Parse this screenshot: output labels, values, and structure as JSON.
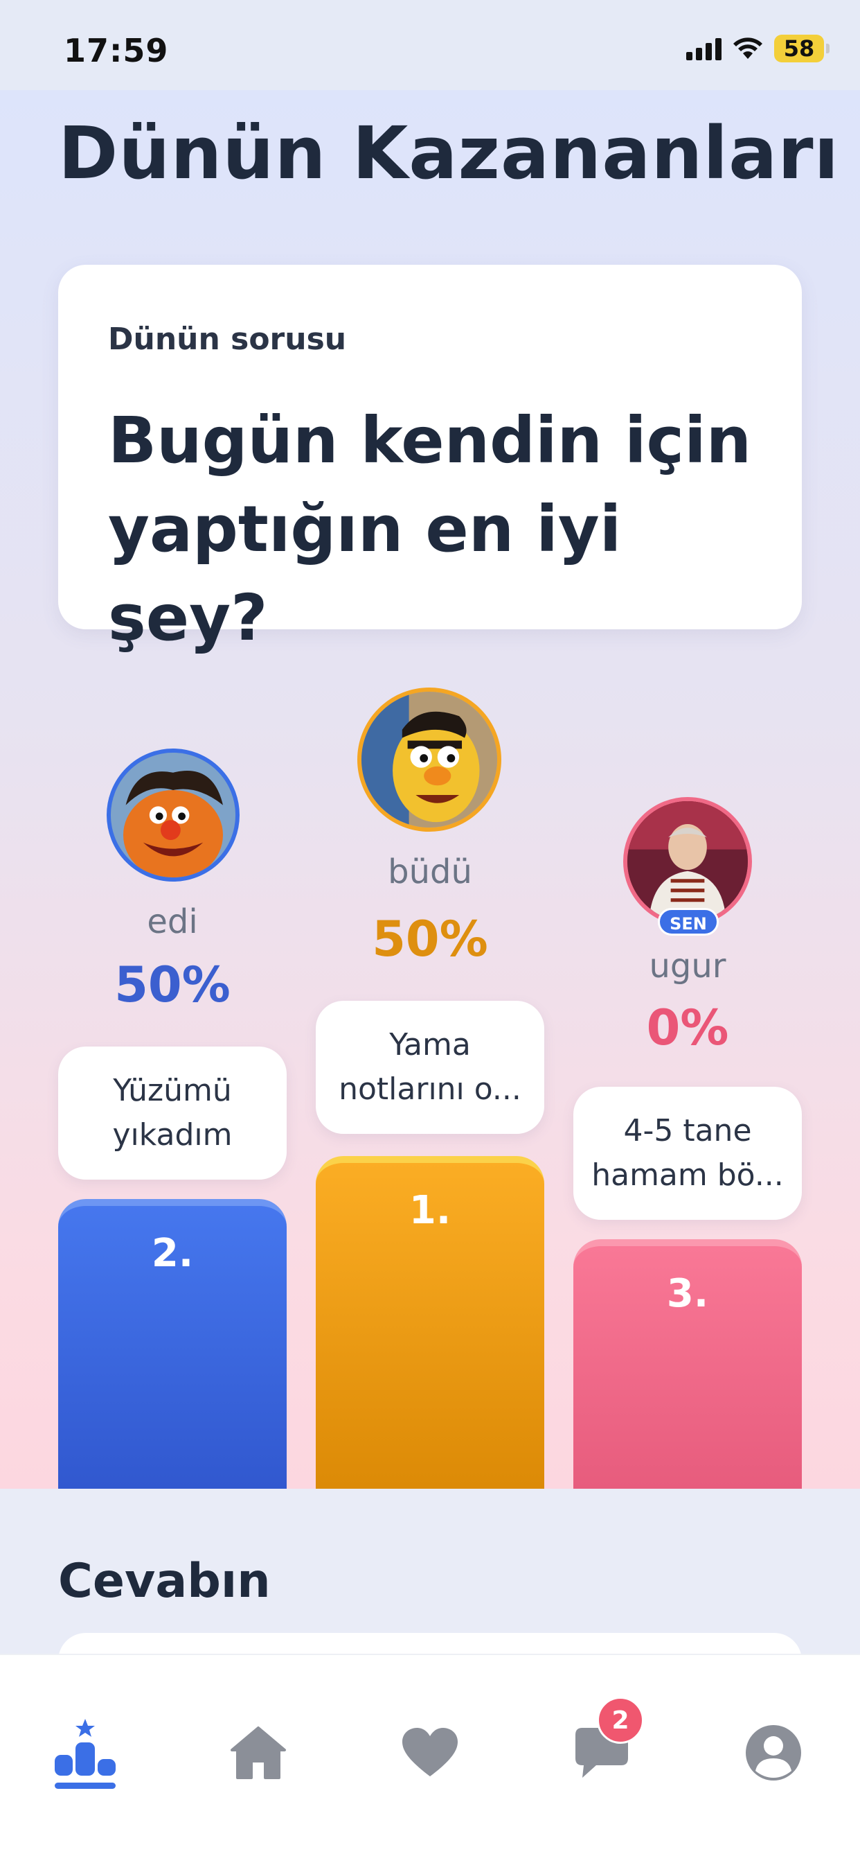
{
  "status_bar": {
    "time": "17:59",
    "battery": "58"
  },
  "page_title": "Dünün Kazananları",
  "question": {
    "label": "Dünün sorusu",
    "text": "Bugün kendin için yaptığın en iyi şey?"
  },
  "winners": [
    {
      "rank": "1.",
      "name": "büdü",
      "percent": "50%",
      "answer": "Yama notlarını o...",
      "color": "#f5a623"
    },
    {
      "rank": "2.",
      "name": "edi",
      "percent": "50%",
      "answer": "Yüzümü yıkadım",
      "color": "#3b63d9"
    },
    {
      "rank": "3.",
      "name": "ugur",
      "percent": "0%",
      "answer": "4-5 tane hamam bö...",
      "color": "#f06a87",
      "badge": "SEN"
    }
  ],
  "your_answer": {
    "title": "Cevabın"
  },
  "tabs": [
    {
      "name": "leaderboard",
      "icon": "podium-icon",
      "active": true
    },
    {
      "name": "home",
      "icon": "home-icon"
    },
    {
      "name": "favorites",
      "icon": "heart-icon"
    },
    {
      "name": "messages",
      "icon": "chat-icon",
      "badge": "2"
    },
    {
      "name": "profile",
      "icon": "user-icon"
    }
  ],
  "colors": {
    "active_tab": "#3b6fe6",
    "inactive_tab": "#8b8f98",
    "title": "#1f2a3d"
  }
}
